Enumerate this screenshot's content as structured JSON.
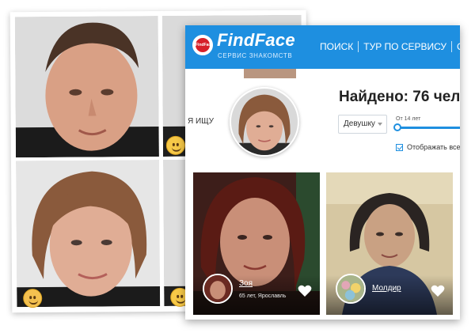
{
  "app": {
    "brand": "FindFace",
    "tagline": "СЕРВИС ЗНАКОМСТВ",
    "logo_text": "FindFace"
  },
  "nav": {
    "items": [
      "ПОИСК",
      "ТУР ПО СЕРВИСУ",
      "СИ"
    ]
  },
  "search": {
    "i_search_label": "Я ИЩУ",
    "found_text": "Найдено: 76 чел",
    "gender_value": "Девушку",
    "age_label": "От 14 лет",
    "checkbox_label": "Отображать всех",
    "checkbox_checked": true
  },
  "results": [
    {
      "name": "Зоя",
      "details": "65 лет, Ярославль"
    },
    {
      "name": "Молдир",
      "details": ""
    }
  ],
  "icons": {
    "collage_emoji": [
      "grinning-emoji-icon",
      "blonde-woman-emoji-icon",
      "nerd-emoji-icon"
    ],
    "heart": "heart-icon"
  },
  "colors": {
    "accent": "#1e8fe0",
    "logo_red": "#d6202a"
  }
}
